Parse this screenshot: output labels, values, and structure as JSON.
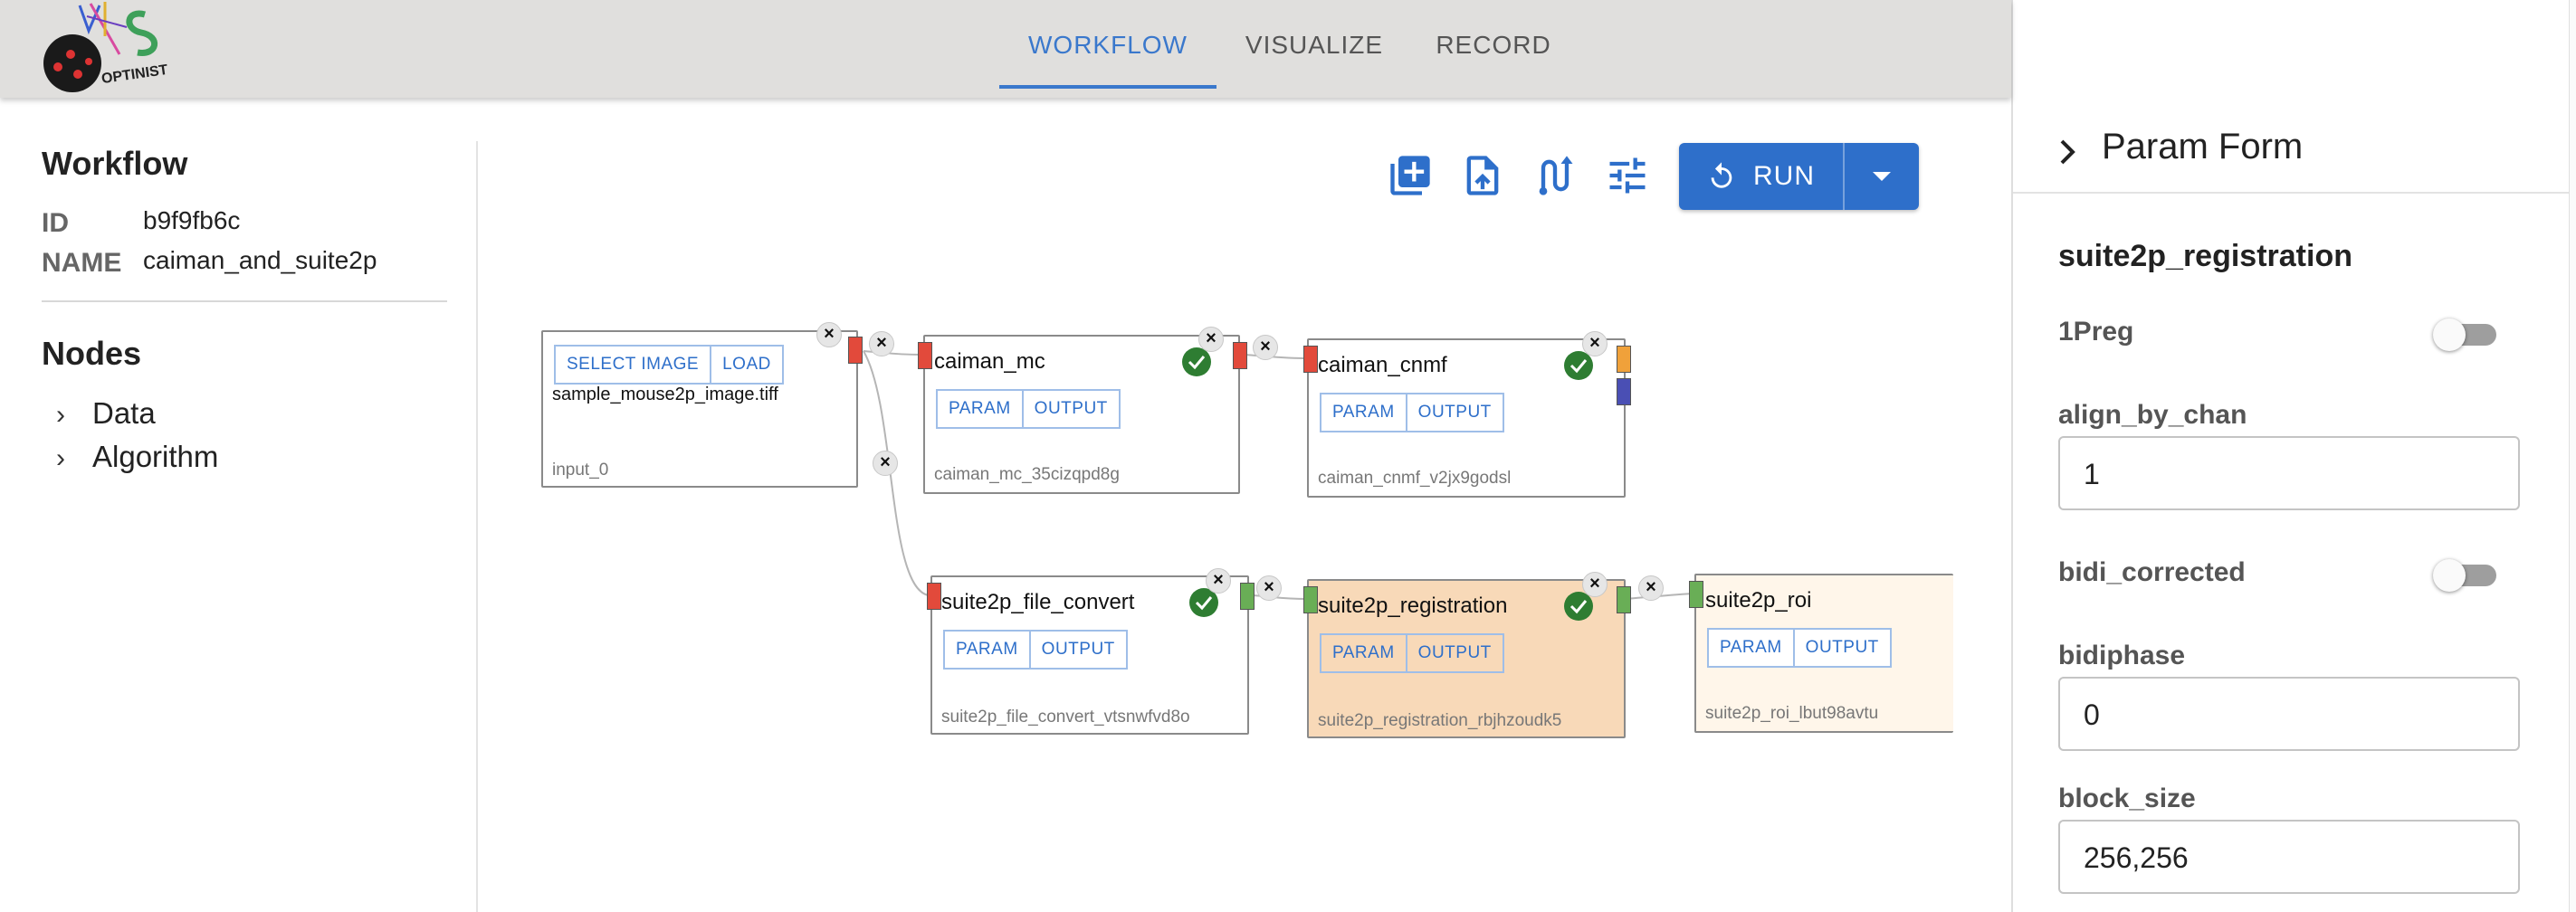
{
  "header": {
    "logo_text": "OPTINIST",
    "tabs": [
      {
        "label": "WORKFLOW",
        "active": true
      },
      {
        "label": "VISUALIZE",
        "active": false
      },
      {
        "label": "RECORD",
        "active": false
      }
    ],
    "accent_color": "#3a78cc"
  },
  "workflow": {
    "heading": "Workflow",
    "id_key": "ID",
    "id_value": "b9f9fb6c",
    "name_key": "NAME",
    "name_value": "caiman_and_suite2p"
  },
  "nodes_panel": {
    "heading": "Nodes",
    "items": [
      {
        "label": "Data"
      },
      {
        "label": "Algorithm"
      }
    ]
  },
  "toolbar": {
    "icons": [
      "add-box-icon",
      "upload-file-icon",
      "route-icon",
      "tune-icon"
    ],
    "run_label": "RUN",
    "run_color": "#2e6fca"
  },
  "flow": {
    "input_node": {
      "select_label": "SELECT IMAGE",
      "load_label": "LOAD",
      "file_name": "sample_mouse2p_image.tiff",
      "id": "input_0"
    },
    "algo_nodes": [
      {
        "title": "caiman_mc",
        "id": "caiman_mc_35cizqpd8g",
        "param": "PARAM",
        "output": "OUTPUT",
        "status": "success"
      },
      {
        "title": "caiman_cnmf",
        "id": "caiman_cnmf_v2jx9godsl",
        "param": "PARAM",
        "output": "OUTPUT",
        "status": "success"
      },
      {
        "title": "suite2p_file_convert",
        "id": "suite2p_file_convert_vtsnwfvd8o",
        "param": "PARAM",
        "output": "OUTPUT",
        "status": "success"
      },
      {
        "title": "suite2p_registration",
        "id": "suite2p_registration_rbjhzoudk5",
        "param": "PARAM",
        "output": "OUTPUT",
        "status": "success"
      },
      {
        "title": "suite2p_roi",
        "id": "suite2p_roi_lbut98avtu",
        "param": "PARAM",
        "output": "OUTPUT",
        "status": "none"
      }
    ],
    "close_glyph": "×"
  },
  "param_form": {
    "title": "Param Form",
    "algorithm": "suite2p_registration",
    "params": [
      {
        "key": "1Preg",
        "type": "toggle",
        "on": false
      },
      {
        "key": "align_by_chan",
        "type": "text",
        "value": "1"
      },
      {
        "key": "bidi_corrected",
        "type": "toggle",
        "on": false
      },
      {
        "key": "bidiphase",
        "type": "text",
        "value": "0"
      },
      {
        "key": "block_size",
        "type": "text",
        "value": "256,256"
      }
    ]
  }
}
